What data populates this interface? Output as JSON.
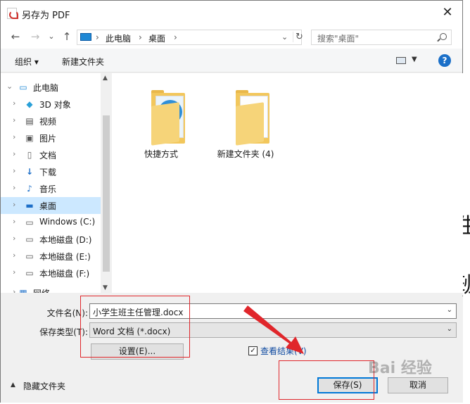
{
  "window": {
    "title": "另存为 PDF",
    "close_glyph": "✕"
  },
  "nav": {
    "back_glyph": "←",
    "forward_glyph": "→",
    "recent_glyph": "⌄",
    "up_glyph": "↑",
    "breadcrumb": [
      "此电脑",
      "桌面"
    ],
    "separator": "›",
    "search_placeholder": "搜索\"桌面\""
  },
  "toolbar": {
    "organize": "组织 ▾",
    "new_folder": "新建文件夹",
    "help": "?"
  },
  "sidebar": {
    "items": [
      {
        "label": "此电脑",
        "icon": "computer-icon",
        "expanded": true
      },
      {
        "label": "3D 对象",
        "icon": "3d-objects-icon"
      },
      {
        "label": "视频",
        "icon": "videos-icon"
      },
      {
        "label": "图片",
        "icon": "pictures-icon"
      },
      {
        "label": "文档",
        "icon": "documents-icon"
      },
      {
        "label": "下载",
        "icon": "downloads-icon"
      },
      {
        "label": "音乐",
        "icon": "music-icon"
      },
      {
        "label": "桌面",
        "icon": "desktop-icon",
        "selected": true
      },
      {
        "label": "Windows (C:)",
        "icon": "windows-drive-icon"
      },
      {
        "label": "本地磁盘 (D:)",
        "icon": "drive-icon"
      },
      {
        "label": "本地磁盘 (E:)",
        "icon": "drive-icon"
      },
      {
        "label": "本地磁盘 (F:)",
        "icon": "drive-icon"
      },
      {
        "label": "网络",
        "icon": "network-icon"
      }
    ]
  },
  "files": [
    {
      "label": "快捷方式",
      "icon": "folder-icon"
    },
    {
      "label": "新建文件夹 (4)",
      "icon": "folder-icon"
    }
  ],
  "form": {
    "filename_label": "文件名(N):",
    "filename_value": "小学生班主任管理.docx",
    "filetype_label": "保存类型(T):",
    "filetype_value": "Word 文档 (*.docx)",
    "settings_button": "设置(E)...",
    "view_results_label": "查看结果(V)",
    "view_results_checked": true,
    "hide_folders": "隐藏文件夹",
    "save_button": "保存(S)",
    "cancel_button": "取消"
  },
  "background": {
    "glyph_top": "生",
    "glyph_bottom": "班"
  },
  "watermark": "Bai 经验",
  "colors": {
    "accent": "#0078d7",
    "annotation_red": "#e0262b",
    "selection": "#cce8ff"
  }
}
